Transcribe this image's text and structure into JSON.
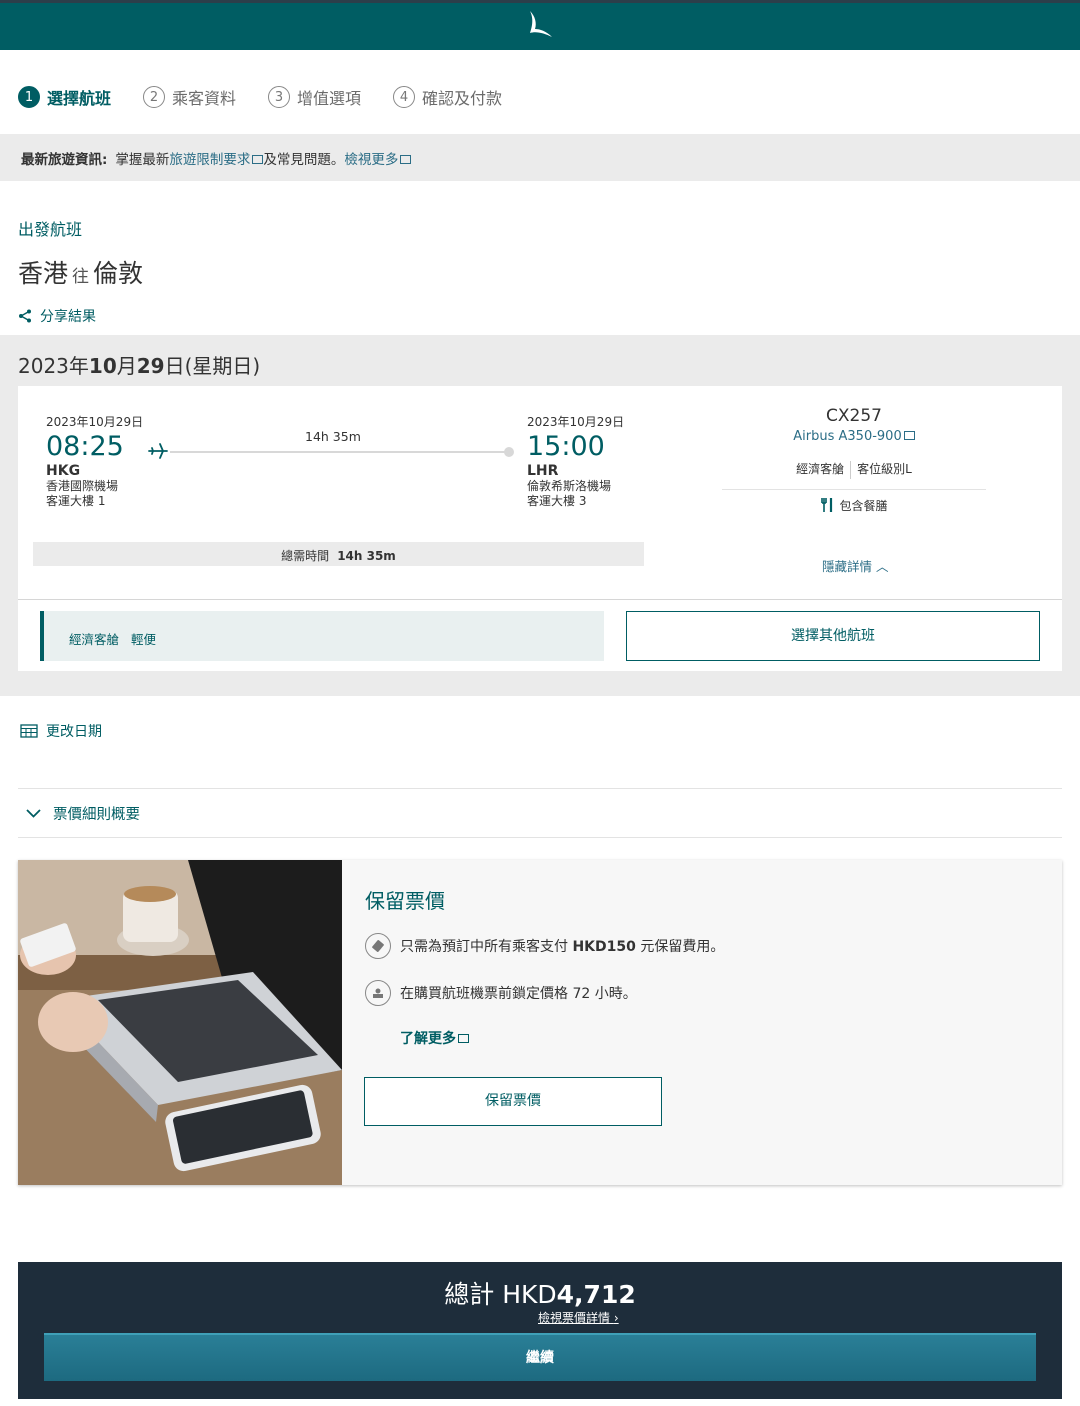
{
  "header": {
    "logo": "brushwing-logo"
  },
  "steps": [
    {
      "num": "1",
      "label": "選擇航班"
    },
    {
      "num": "2",
      "label": "乘客資料"
    },
    {
      "num": "3",
      "label": "增值選項"
    },
    {
      "num": "4",
      "label": "確認及付款"
    }
  ],
  "notice": {
    "label": "最新旅遊資訊:",
    "text1": "掌握最新",
    "link1": "旅遊限制要求",
    "text2": "及常見問題。",
    "link2": "檢視更多"
  },
  "flight": {
    "section_label": "出發航班",
    "origin": "香港",
    "to": "往",
    "destination": "倫敦",
    "share": "分享結果",
    "date_heading_pre": "2023年",
    "date_heading_b1": "10",
    "date_heading_mid": "月",
    "date_heading_b2": "29",
    "date_heading_post": "日(星期日)",
    "dep": {
      "date": "2023年10月29日",
      "time": "08:25",
      "code": "HKG",
      "airport": "香港國際機場",
      "terminal": "客運大樓 1"
    },
    "arr": {
      "date": "2023年10月29日",
      "time": "15:00",
      "code": "LHR",
      "airport": "倫敦希斯洛機場",
      "terminal": "客運大樓 3"
    },
    "duration": "14h 35m",
    "total_time_label": "總需時間",
    "total_time": "14h 35m",
    "flight_no": "CX257",
    "aircraft": "Airbus A350-900",
    "cabin": "經濟客艙",
    "fare_class": "客位級別L",
    "meal": "包含餐膳",
    "hide_details": "隱藏詳情",
    "fare_cabin": "經濟客艙",
    "fare_type": "輕便",
    "other_flights": "選擇其他航班"
  },
  "links": {
    "change_date": "更改日期",
    "fare_rules": "票價細則概要"
  },
  "hold": {
    "title": "保留票價",
    "item1_pre": "只需為預訂中所有乘客支付 ",
    "item1_bold": "HKD150",
    "item1_post": " 元保留費用。",
    "item2": "在購買航班機票前鎖定價格 72 小時。",
    "learn_more": "了解更多",
    "button": "保留票價"
  },
  "footer": {
    "total_label": "總計 HKD",
    "total_amount": "4,712",
    "view_details": "檢視票價詳情",
    "continue": "繼續"
  },
  "colors": {
    "brand": "#005d63",
    "link": "#2b6d86",
    "footer": "#1e2d3b"
  }
}
